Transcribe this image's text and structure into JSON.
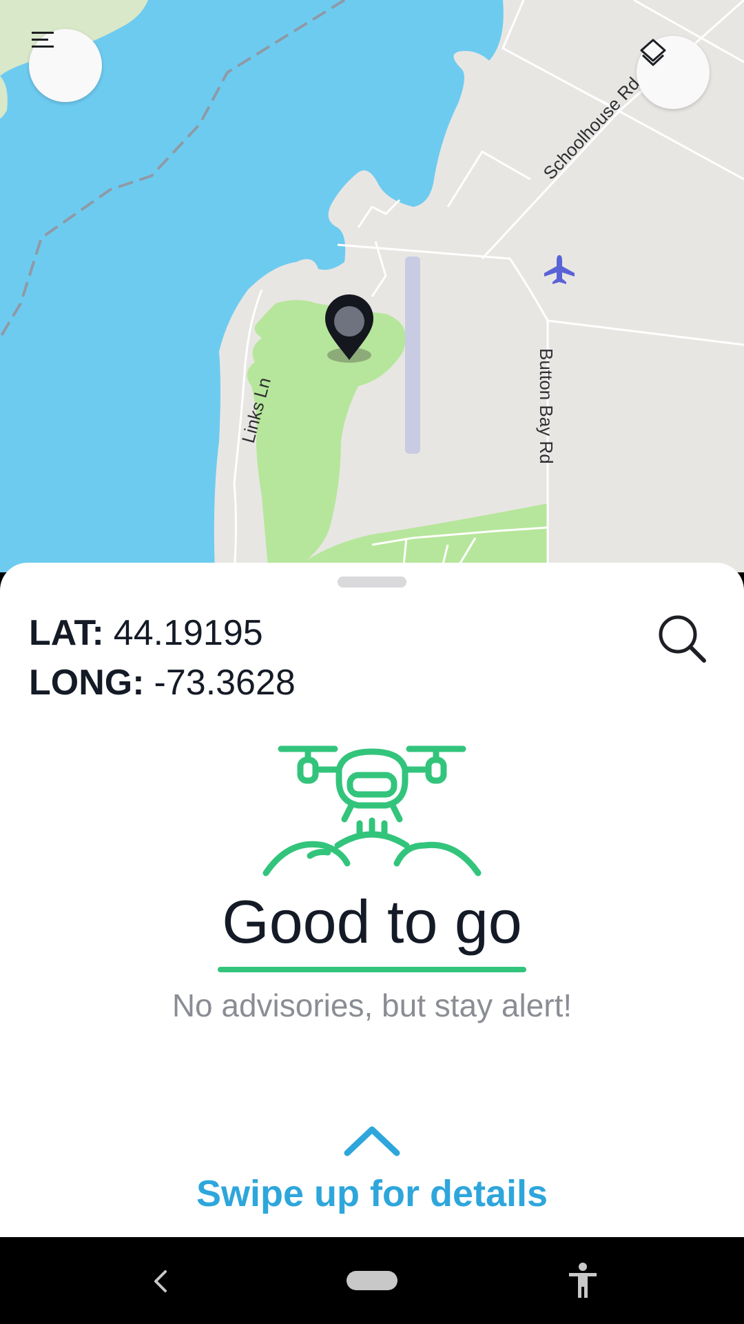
{
  "map": {
    "road_labels": {
      "schoolhouse": "Schoolhouse Rd",
      "button_bay": "Button Bay Rd",
      "links": "Links Ln"
    },
    "icons": {
      "menu": "menu-icon",
      "layers": "layers-icon",
      "pin": "location-pin-icon",
      "airport": "airplane-icon"
    },
    "colors": {
      "water": "#6ecbf0",
      "land": "#e8e6e3",
      "park": "#b6e69b",
      "pin": "#15171f"
    }
  },
  "sheet": {
    "lat_label": "LAT:",
    "lat_value": "44.19195",
    "long_label": "LONG:",
    "long_value": "-73.3628",
    "search_icon": "search-icon",
    "status_icon": "drone-icon",
    "status_title": "Good to go",
    "status_subtitle": "No advisories, but stay alert!",
    "swipe_icon": "chevron-up-icon",
    "swipe_label": "Swipe up for details",
    "colors": {
      "status_green": "#33c47c",
      "swipe_blue": "#2ea6dc",
      "text_dark": "#141a26"
    }
  },
  "navbar": {
    "back_icon": "back-icon",
    "home_icon": "home-pill-icon",
    "accessibility_icon": "accessibility-icon"
  }
}
